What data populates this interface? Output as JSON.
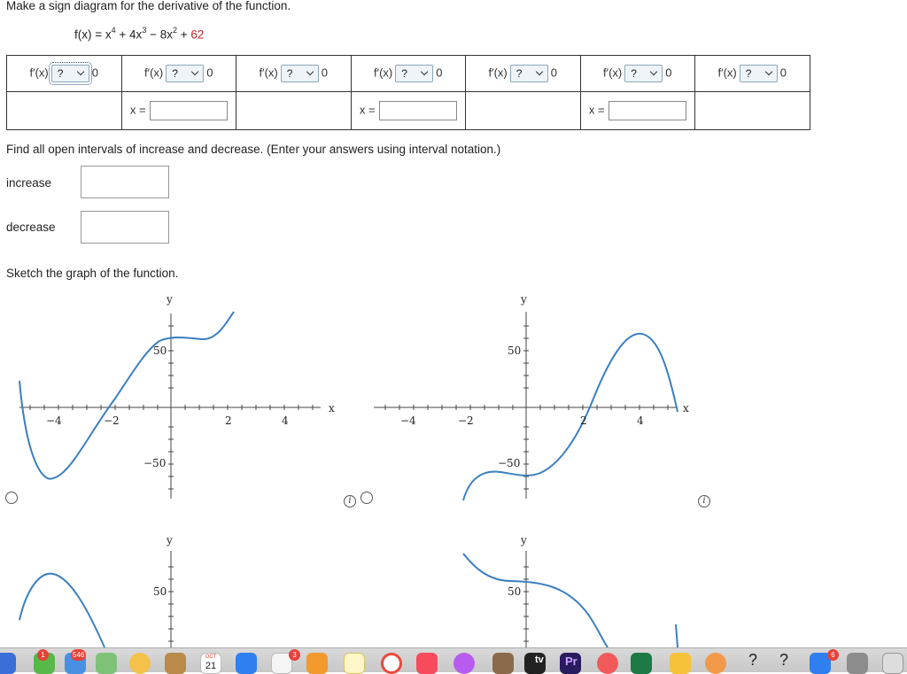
{
  "question": {
    "prompt": "Make a sign diagram for the derivative of the function.",
    "function_lhs": "f(x) = x",
    "exp4": "4",
    "plus1": " + 4x",
    "exp3": "3",
    "minus": " − 8x",
    "exp2": "2",
    "plus2": " + ",
    "constant": "62"
  },
  "sign_table": {
    "cell_label": "f′(x)",
    "select_value": "?",
    "zero": "0",
    "x_label": "x ="
  },
  "intervals": {
    "prompt": "Find all open intervals of increase and decrease. (Enter your answers using interval notation.)",
    "increase_label": "increase",
    "decrease_label": "decrease"
  },
  "sketch": {
    "prompt": "Sketch the graph of the function.",
    "x_axis_label": "x",
    "y_axis_label": "y",
    "tick_labels": {
      "m4": "−4",
      "m2": "−2",
      "p2": "2",
      "p4": "4",
      "y50": "50",
      "ym50": "−50"
    },
    "info_glyph": "i"
  },
  "dock": {
    "badges": {
      "mail": "546",
      "app1": "1",
      "app2": "3",
      "app3": "6"
    },
    "calendar_month": "OCT",
    "calendar_day": "21",
    "tv_label": "tv",
    "pr_label": "Pr",
    "q_label": "?",
    "colors": {
      "bar": "#cfcfcf"
    }
  }
}
